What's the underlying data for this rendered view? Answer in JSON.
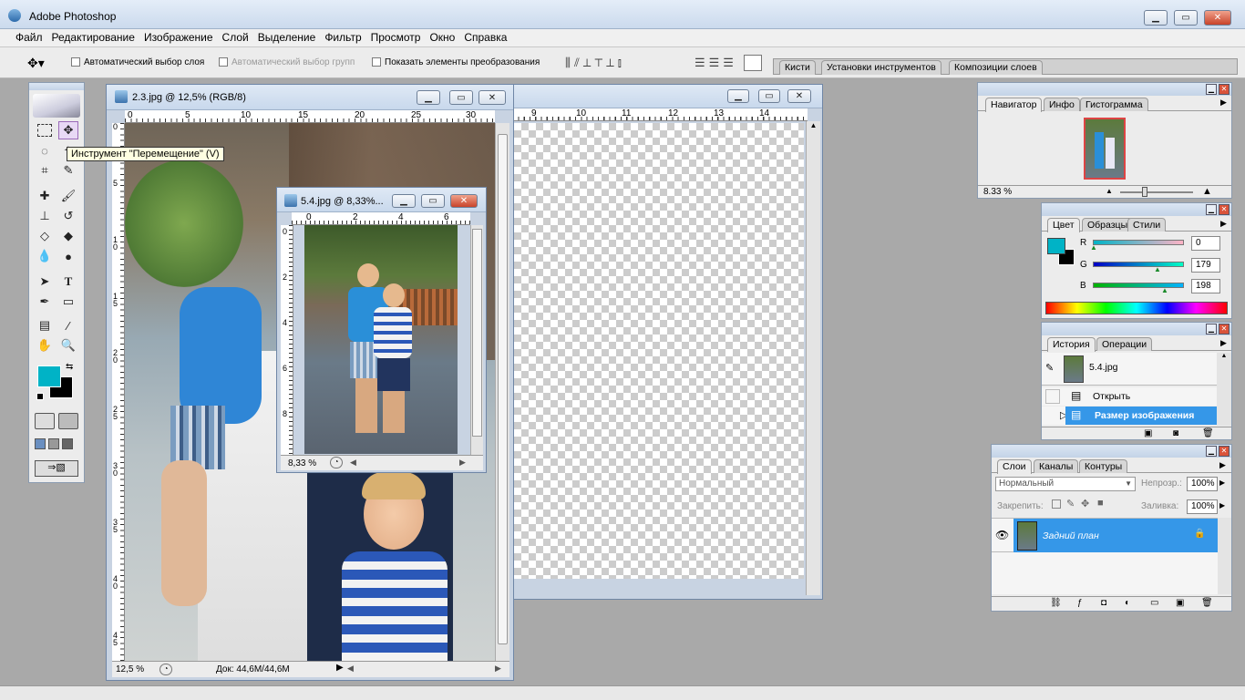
{
  "app": {
    "title": "Adobe Photoshop"
  },
  "menu": [
    "Файл",
    "Редактирование",
    "Изображение",
    "Слой",
    "Выделение",
    "Фильтр",
    "Просмотр",
    "Окно",
    "Справка"
  ],
  "options": {
    "auto_select_layer": "Автоматический выбор слоя",
    "auto_select_groups": "Автоматический выбор групп",
    "show_transform": "Показать элементы преобразования",
    "well_tabs": [
      "Кисти",
      "Установки инструментов",
      "Композиции слоев"
    ]
  },
  "tooltip": "Инструмент \"Перемещение\" (V)",
  "doc_main": {
    "title": "2.3.jpg @ 12,5% (RGB/8)",
    "ruler_top": [
      "0",
      "5",
      "10",
      "15",
      "20",
      "25",
      "30"
    ],
    "ruler_left": [
      "0",
      "5",
      "1\n0",
      "1\n5",
      "2\n0",
      "2\n5",
      "3\n0",
      "3\n5",
      "4\n0",
      "4\n5"
    ],
    "zoom": "12,5 %",
    "doc_size": "Док: 44,6M/44,6M"
  },
  "doc_back": {
    "ruler_top": [
      "9",
      "10",
      "11",
      "12",
      "13",
      "14"
    ]
  },
  "doc_small": {
    "title": "5.4.jpg @ 8,33%...",
    "ruler_top": [
      "0",
      "2",
      "4",
      "6"
    ],
    "ruler_left": [
      "0",
      "2",
      "4",
      "6",
      "8"
    ],
    "zoom": "8,33 %"
  },
  "navigator": {
    "tabs": [
      "Навигатор",
      "Инфо",
      "Гистограмма"
    ],
    "zoom": "8.33 %"
  },
  "color": {
    "tabs": [
      "Цвет",
      "Образцы",
      "Стили"
    ],
    "channels": [
      {
        "label": "R",
        "value": "0",
        "level": 0
      },
      {
        "label": "G",
        "value": "179",
        "level": 0.7
      },
      {
        "label": "B",
        "value": "198",
        "level": 0.78
      }
    ],
    "foreground": "#00b3c6",
    "background": "#000000"
  },
  "history": {
    "tabs": [
      "История",
      "Операции"
    ],
    "snapshot": "5.4.jpg",
    "items": [
      "Открыть",
      "Размер изображения"
    ]
  },
  "layers": {
    "tabs": [
      "Слои",
      "Каналы",
      "Контуры"
    ],
    "blend": "Нормальный",
    "opacity_label": "Непрозр.:",
    "opacity": "100%",
    "lock_label": "Закрепить:",
    "fill_label": "Заливка:",
    "fill": "100%",
    "layer_name": "Задний план"
  }
}
